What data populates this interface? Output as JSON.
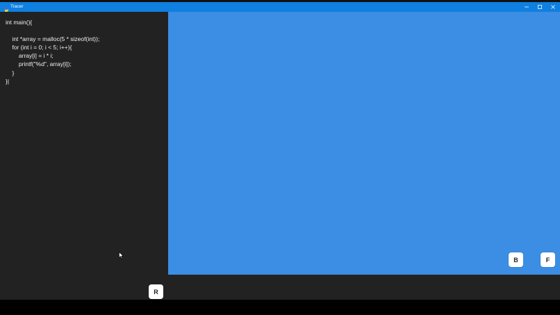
{
  "window": {
    "title": "Tracer",
    "icon": "python-icon",
    "controls": [
      "minimize-icon",
      "maximize-icon",
      "close-icon"
    ]
  },
  "code": {
    "lines": [
      "int main(){",
      "",
      "    int *array = malloc(5 * sizeof(int));",
      "    for (int i = 0; i < 5; i++){",
      "        array[i] = i * i;",
      "        printf(\"%d\", array[i]);",
      "    }",
      "}|"
    ]
  },
  "buttons": {
    "reset_label": "R",
    "back_label": "B",
    "forward_label": "F"
  },
  "colors": {
    "titlebar": "#0f7fe0",
    "code_background": "#222222",
    "visualization_background": "#3b8ee3",
    "code_text": "#f0f0f0",
    "button_background": "#ffffff"
  }
}
